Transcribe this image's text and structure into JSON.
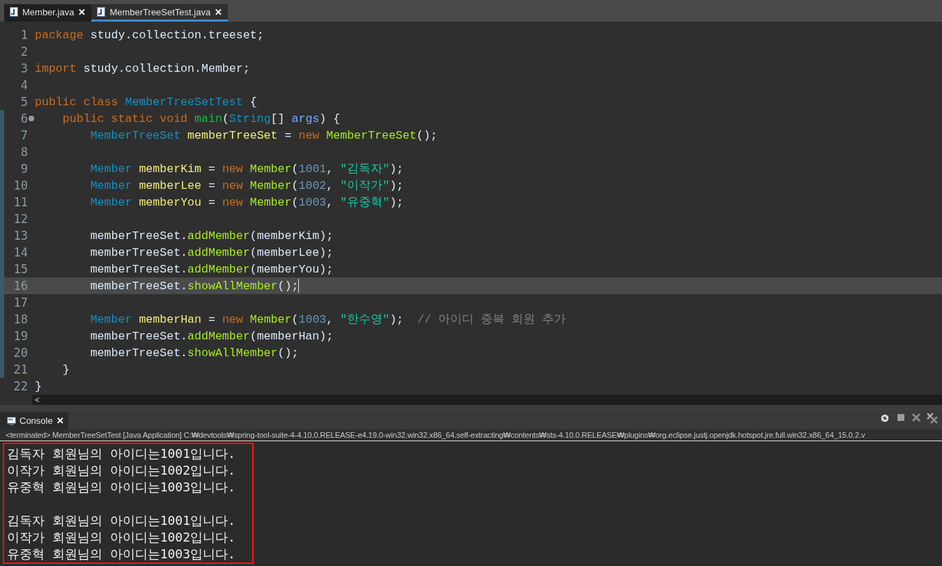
{
  "tabs": [
    {
      "label": "Member.java",
      "close": "✕",
      "selected": false
    },
    {
      "label": "MemberTreeSetTest.java",
      "close": "✕",
      "selected": true
    }
  ],
  "editor": {
    "lines": [
      {
        "number": "1",
        "current": false,
        "fold": false,
        "tokens": [
          {
            "text": "package",
            "kind": "keyword"
          },
          {
            "text": " study.collection.treeset;",
            "kind": "plain"
          }
        ]
      },
      {
        "number": "2",
        "current": false,
        "fold": false
      },
      {
        "number": "3",
        "current": false,
        "fold": false,
        "tokens": [
          {
            "text": "import",
            "kind": "keyword"
          },
          {
            "text": " study.collection.Member;",
            "kind": "plain"
          }
        ]
      },
      {
        "number": "4",
        "current": false,
        "fold": false
      },
      {
        "number": "5",
        "current": false,
        "fold": false,
        "tokens": [
          {
            "text": "public class",
            "kind": "keyword"
          },
          {
            "text": " MemberTreeSetTest",
            "kind": "type"
          },
          {
            "text": " {",
            "kind": "plain"
          }
        ]
      },
      {
        "number": "6",
        "current": false,
        "fold": true,
        "tokens": [
          {
            "text": "    public static void",
            "kind": "keyword"
          },
          {
            "text": " main",
            "kind": "method_decl"
          },
          {
            "text": "(",
            "kind": "plain"
          },
          {
            "text": "String",
            "kind": "type"
          },
          {
            "text": "[]",
            "kind": "plain"
          },
          {
            "text": " args",
            "kind": "param"
          },
          {
            "text": ") {",
            "kind": "plain"
          }
        ]
      },
      {
        "number": "7",
        "current": false,
        "fold": false,
        "tokens": [
          {
            "text": "        MemberTreeSet",
            "kind": "type"
          },
          {
            "text": " memberTreeSet",
            "kind": "variable"
          },
          {
            "text": " =",
            "kind": "plain"
          },
          {
            "text": " new",
            "kind": "keyword"
          },
          {
            "text": " MemberTreeSet",
            "kind": "method"
          },
          {
            "text": "();",
            "kind": "plain"
          }
        ]
      },
      {
        "number": "8",
        "current": false,
        "fold": false
      },
      {
        "number": "9",
        "current": false,
        "fold": false,
        "tokens": [
          {
            "text": "        Member",
            "kind": "type"
          },
          {
            "text": " memberKim",
            "kind": "variable"
          },
          {
            "text": " =",
            "kind": "plain"
          },
          {
            "text": " new",
            "kind": "keyword"
          },
          {
            "text": " Member",
            "kind": "method"
          },
          {
            "text": "(",
            "kind": "plain"
          },
          {
            "text": "1001",
            "kind": "number"
          },
          {
            "text": ",",
            "kind": "plain"
          },
          {
            "text": " \"김독자\"",
            "kind": "string"
          },
          {
            "text": ");",
            "kind": "plain"
          }
        ]
      },
      {
        "number": "10",
        "current": false,
        "fold": false,
        "tokens": [
          {
            "text": "        Member",
            "kind": "type"
          },
          {
            "text": " memberLee",
            "kind": "variable"
          },
          {
            "text": " =",
            "kind": "plain"
          },
          {
            "text": " new",
            "kind": "keyword"
          },
          {
            "text": " Member",
            "kind": "method"
          },
          {
            "text": "(",
            "kind": "plain"
          },
          {
            "text": "1002",
            "kind": "number"
          },
          {
            "text": ",",
            "kind": "plain"
          },
          {
            "text": " \"이작가\"",
            "kind": "string"
          },
          {
            "text": ");",
            "kind": "plain"
          }
        ]
      },
      {
        "number": "11",
        "current": false,
        "fold": false,
        "tokens": [
          {
            "text": "        Member",
            "kind": "type"
          },
          {
            "text": " memberYou",
            "kind": "variable"
          },
          {
            "text": " =",
            "kind": "plain"
          },
          {
            "text": " new",
            "kind": "keyword"
          },
          {
            "text": " Member",
            "kind": "method"
          },
          {
            "text": "(",
            "kind": "plain"
          },
          {
            "text": "1003",
            "kind": "number"
          },
          {
            "text": ",",
            "kind": "plain"
          },
          {
            "text": " \"유중혁\"",
            "kind": "string"
          },
          {
            "text": ");",
            "kind": "plain"
          }
        ]
      },
      {
        "number": "12",
        "current": false,
        "fold": false
      },
      {
        "number": "13",
        "current": false,
        "fold": false,
        "tokens": [
          {
            "text": "        memberTreeSet.",
            "kind": "plain"
          },
          {
            "text": "addMember",
            "kind": "method"
          },
          {
            "text": "(memberKim);",
            "kind": "plain"
          }
        ]
      },
      {
        "number": "14",
        "current": false,
        "fold": false,
        "tokens": [
          {
            "text": "        memberTreeSet.",
            "kind": "plain"
          },
          {
            "text": "addMember",
            "kind": "method"
          },
          {
            "text": "(memberLee);",
            "kind": "plain"
          }
        ]
      },
      {
        "number": "15",
        "current": false,
        "fold": false,
        "tokens": [
          {
            "text": "        memberTreeSet.",
            "kind": "plain"
          },
          {
            "text": "addMember",
            "kind": "method"
          },
          {
            "text": "(memberYou);",
            "kind": "plain"
          }
        ]
      },
      {
        "number": "16",
        "current": true,
        "fold": false,
        "tokens": [
          {
            "text": "        memberTreeSet.",
            "kind": "plain"
          },
          {
            "text": "showAllMember",
            "kind": "method"
          },
          {
            "text": "();",
            "kind": "plain"
          }
        ]
      },
      {
        "number": "17",
        "current": false,
        "fold": false
      },
      {
        "number": "18",
        "current": false,
        "fold": false,
        "tokens": [
          {
            "text": "        Member",
            "kind": "type"
          },
          {
            "text": " memberHan",
            "kind": "variable"
          },
          {
            "text": " =",
            "kind": "plain"
          },
          {
            "text": " new",
            "kind": "keyword"
          },
          {
            "text": " Member",
            "kind": "method"
          },
          {
            "text": "(",
            "kind": "plain"
          },
          {
            "text": "1003",
            "kind": "number"
          },
          {
            "text": ",",
            "kind": "plain"
          },
          {
            "text": " \"한수영\"",
            "kind": "string"
          },
          {
            "text": ");",
            "kind": "plain"
          },
          {
            "text": "  // 아이디 중복 회원 추가",
            "kind": "comment"
          }
        ]
      },
      {
        "number": "19",
        "current": false,
        "fold": false,
        "tokens": [
          {
            "text": "        memberTreeSet.",
            "kind": "plain"
          },
          {
            "text": "addMember",
            "kind": "method"
          },
          {
            "text": "(memberHan);",
            "kind": "plain"
          }
        ]
      },
      {
        "number": "20",
        "current": false,
        "fold": false,
        "tokens": [
          {
            "text": "        memberTreeSet.",
            "kind": "plain"
          },
          {
            "text": "showAllMember",
            "kind": "method"
          },
          {
            "text": "();",
            "kind": "plain"
          }
        ]
      },
      {
        "number": "21",
        "current": false,
        "fold": false,
        "tokens": [
          {
            "text": "    }",
            "kind": "plain"
          }
        ]
      },
      {
        "number": "22",
        "current": false,
        "fold": false,
        "tokens": [
          {
            "text": "}",
            "kind": "plain"
          }
        ]
      }
    ],
    "scroll_left": "<"
  },
  "console": {
    "tab": {
      "label": "Console",
      "close": "✕",
      "selected": true
    },
    "status": "<terminated>  MemberTreeSetTest [Java Application] C:₩devtools₩spring-tool-suite-4-4.10.0.RELEASE-e4.19.0-win32.win32.x86_64.self-extracting₩contents₩sts-4.10.0.RELEASE₩plugins₩org.eclipse.justj.openjdk.hotspot.jre.full.win32.x86_64_15.0.2.v",
    "output_blocks": [
      {
        "lines": [
          "김독자 회원님의 아이디는1001입니다.",
          "이작가 회원님의 아이디는1002입니다.",
          "유중혁 회원님의 아이디는1003입니다."
        ]
      },
      {
        "lines": [
          "김독자 회원님의 아이디는1001입니다.",
          "이작가 회원님의 아이디는1002입니다.",
          "유중혁 회원님의 아이디는1003입니다."
        ]
      }
    ]
  }
}
